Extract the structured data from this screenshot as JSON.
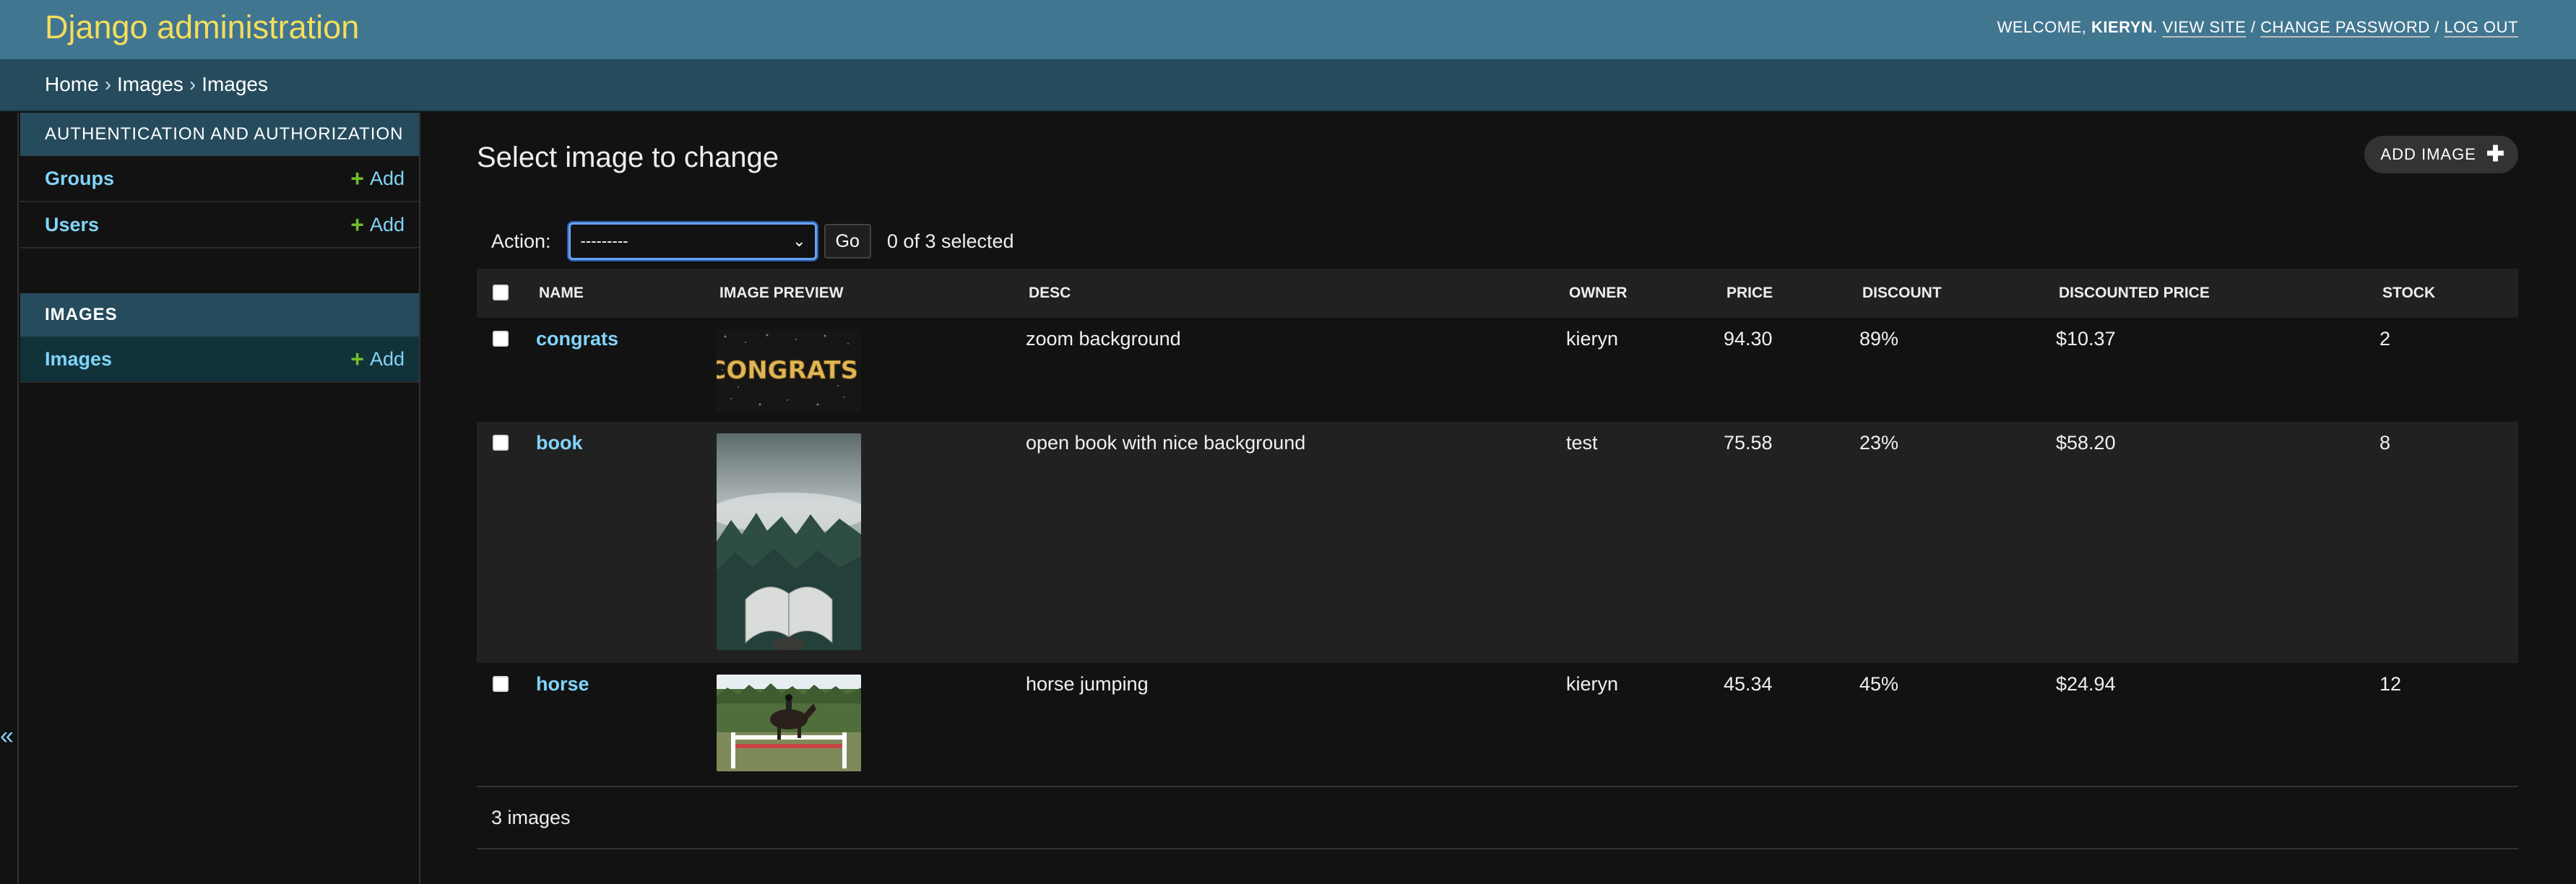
{
  "header": {
    "branding": "Django administration",
    "welcome_label": "WELCOME, ",
    "username": "KIERYN",
    "period": ".",
    "view_site": "VIEW SITE",
    "change_password": "CHANGE PASSWORD",
    "log_out": "LOG OUT",
    "separator": "/"
  },
  "breadcrumbs": {
    "items": [
      "Home",
      "Images",
      "Images"
    ],
    "separator": "›"
  },
  "sidebar": {
    "modules": [
      {
        "caption": "AUTHENTICATION AND AUTHORIZATION",
        "rows": [
          {
            "label": "Groups",
            "add": "Add"
          },
          {
            "label": "Users",
            "add": "Add"
          }
        ]
      },
      {
        "caption": "IMAGES",
        "rows": [
          {
            "label": "Images",
            "add": "Add"
          }
        ]
      }
    ],
    "collapse_glyph": "«"
  },
  "content": {
    "title": "Select image to change",
    "add_button": "ADD IMAGE",
    "action_label": "Action:",
    "action_selected": "---------",
    "go": "Go",
    "selected_count": "0 of 3 selected",
    "columns": [
      "NAME",
      "IMAGE PREVIEW",
      "DESC",
      "OWNER",
      "PRICE",
      "DISCOUNT",
      "DISCOUNTED PRICE",
      "STOCK"
    ],
    "rows": [
      {
        "name": "congrats",
        "preview": "congrats-image",
        "preview_text": "CONGRATS!",
        "desc": "zoom background",
        "owner": "kieryn",
        "price": "94.30",
        "discount": "89%",
        "discounted_price": "$10.37",
        "stock": "2"
      },
      {
        "name": "book",
        "preview": "book-image",
        "desc": "open book with nice background",
        "owner": "test",
        "price": "75.58",
        "discount": "23%",
        "discounted_price": "$58.20",
        "stock": "8"
      },
      {
        "name": "horse",
        "preview": "horse-image",
        "desc": "horse jumping",
        "owner": "kieryn",
        "price": "45.34",
        "discount": "45%",
        "discounted_price": "$24.94",
        "stock": "12"
      }
    ],
    "footer_count": "3 images"
  },
  "colors": {
    "header": "#417690",
    "breadcrumbs": "#264b5d",
    "branding": "#f5dd5d",
    "link": "#81d4fa",
    "add_plus": "#70bf2b",
    "background": "#121212"
  }
}
